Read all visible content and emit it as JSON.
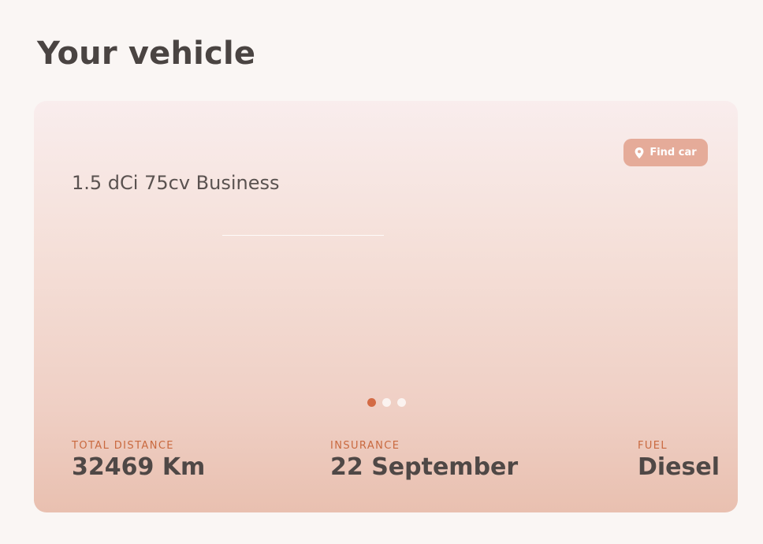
{
  "page": {
    "title": "Your vehicle"
  },
  "vehicle": {
    "model": "1.5 dCi 75cv Business",
    "find_button_label": "Find car",
    "find_button_icon": "map-pin-icon"
  },
  "carousel": {
    "count": 3,
    "active_index": 0
  },
  "stats": {
    "distance": {
      "label": "TOTAL DISTANCE",
      "value": "32469 Km"
    },
    "insurance": {
      "label": "INSURANCE",
      "value": "22 September"
    },
    "fuel": {
      "label": "FUEL",
      "value": "Diesel"
    }
  },
  "colors": {
    "accent": "#d36b45",
    "button": "#e5ab99",
    "background": "#faf6f4"
  }
}
